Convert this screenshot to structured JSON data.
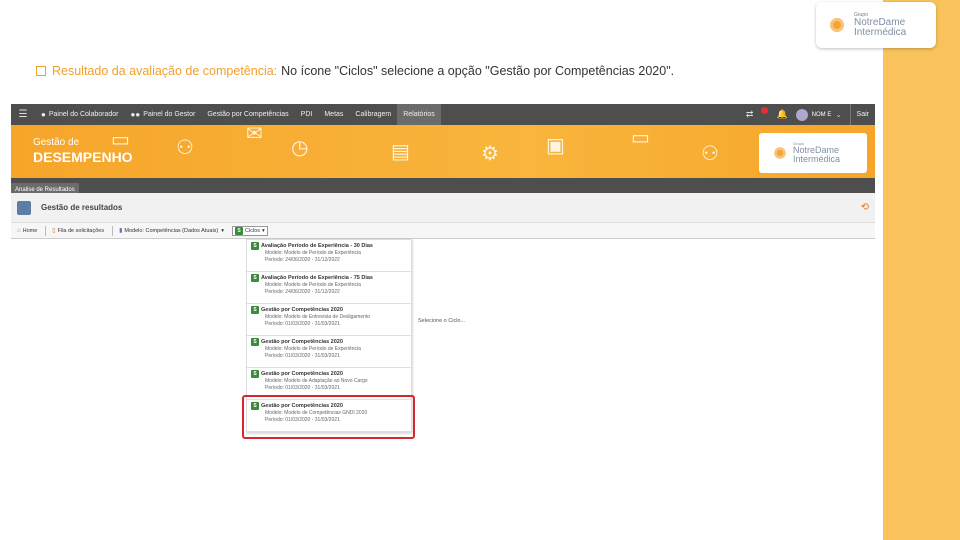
{
  "brand": {
    "group": "Grupo",
    "line1": "NotreDame",
    "line2": "Intermédica"
  },
  "instruction": {
    "title": "Resultado da avaliação de competência:",
    "text": "No ícone \"Ciclos\" selecione a opção \"Gestão por Competências 2020\"."
  },
  "topnav": {
    "items": [
      {
        "label": "Painel do Colaborador",
        "icon": "user-icon"
      },
      {
        "label": "Painel do Gestor",
        "icon": "users-icon"
      },
      {
        "label": "Gestão por Competências"
      },
      {
        "label": "PDI"
      },
      {
        "label": "Metas"
      },
      {
        "label": "Calibragem"
      },
      {
        "label": "Relatórios"
      }
    ],
    "user_name": "NOM E",
    "logout": "Sair"
  },
  "banner": {
    "subtitle": "Gestão de",
    "title": "DESEMPENHO"
  },
  "subbar": {
    "tab": "Analise de Resultados"
  },
  "page": {
    "title": "Gestão de resultados"
  },
  "toolbar": {
    "home": "Home",
    "fila": "Fila de solicitações",
    "modelo": "Modelo: Competências (Dados Atuais)",
    "ciclos": "Ciclos"
  },
  "dropdown": [
    {
      "name": "Avaliação Período de Experiência - 30 Dias",
      "modelo": "Modelo: Modelo de Período de Experiência",
      "periodo": "Período: 24/06/2020 - 31/12/2022"
    },
    {
      "name": "Avaliação Período de Experiência - 75 Dias",
      "modelo": "Modelo: Modelo de Período de Experiência",
      "periodo": "Período: 24/06/2020 - 31/12/2022"
    },
    {
      "name": "Gestão por Competências 2020",
      "modelo": "Modelo: Modelo de Entrevista de Desligamento",
      "periodo": "Período: 01/03/2020 - 31/03/2021"
    },
    {
      "name": "Gestão por Competências 2020",
      "modelo": "Modelo: Modelo de Período de Experiência",
      "periodo": "Período: 01/03/2020 - 31/03/2021"
    },
    {
      "name": "Gestão por Competências 2020",
      "modelo": "Modelo: Modelo de Adaptação ao Novo Cargo",
      "periodo": "Período: 01/03/2020 - 31/03/2021"
    },
    {
      "name": "Gestão por Competências 2020",
      "modelo": "Modelo: Modelo de Competências GNDI 2020",
      "periodo": "Período: 01/03/2020 - 31/03/2021"
    }
  ],
  "select_hint": "Selecione o Ciclo..."
}
